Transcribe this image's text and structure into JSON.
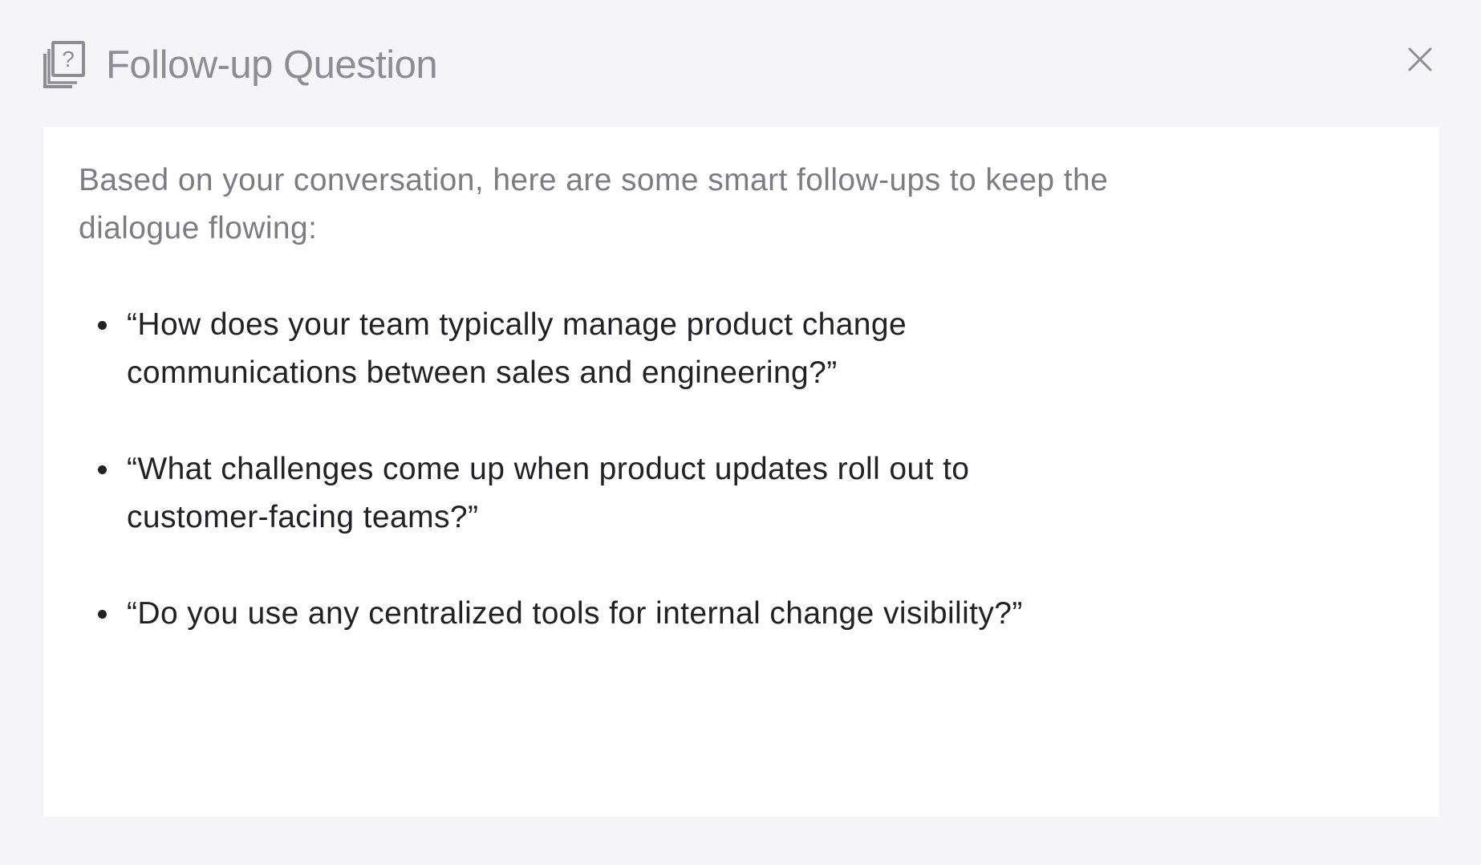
{
  "header": {
    "title": "Follow-up Question",
    "icon": "question-document-icon"
  },
  "close": {
    "icon": "close-icon"
  },
  "content": {
    "intro": "Based on your conversation, here are some smart follow-ups to keep the dialogue flowing:",
    "items": [
      {
        "text": "“How does your team typically manage product change communications between sales and engineering?”"
      },
      {
        "text": "“What challenges come up when product updates roll out to customer-facing teams?”"
      },
      {
        "text": "“Do you use any centralized tools for internal change visibility?”"
      }
    ]
  },
  "colors": {
    "background": "#f5f4f7",
    "card": "#ffffff",
    "title": "#8e8d94",
    "intro_text": "#7d7c84",
    "item_text": "#222126",
    "icon": "#8e8d94"
  }
}
